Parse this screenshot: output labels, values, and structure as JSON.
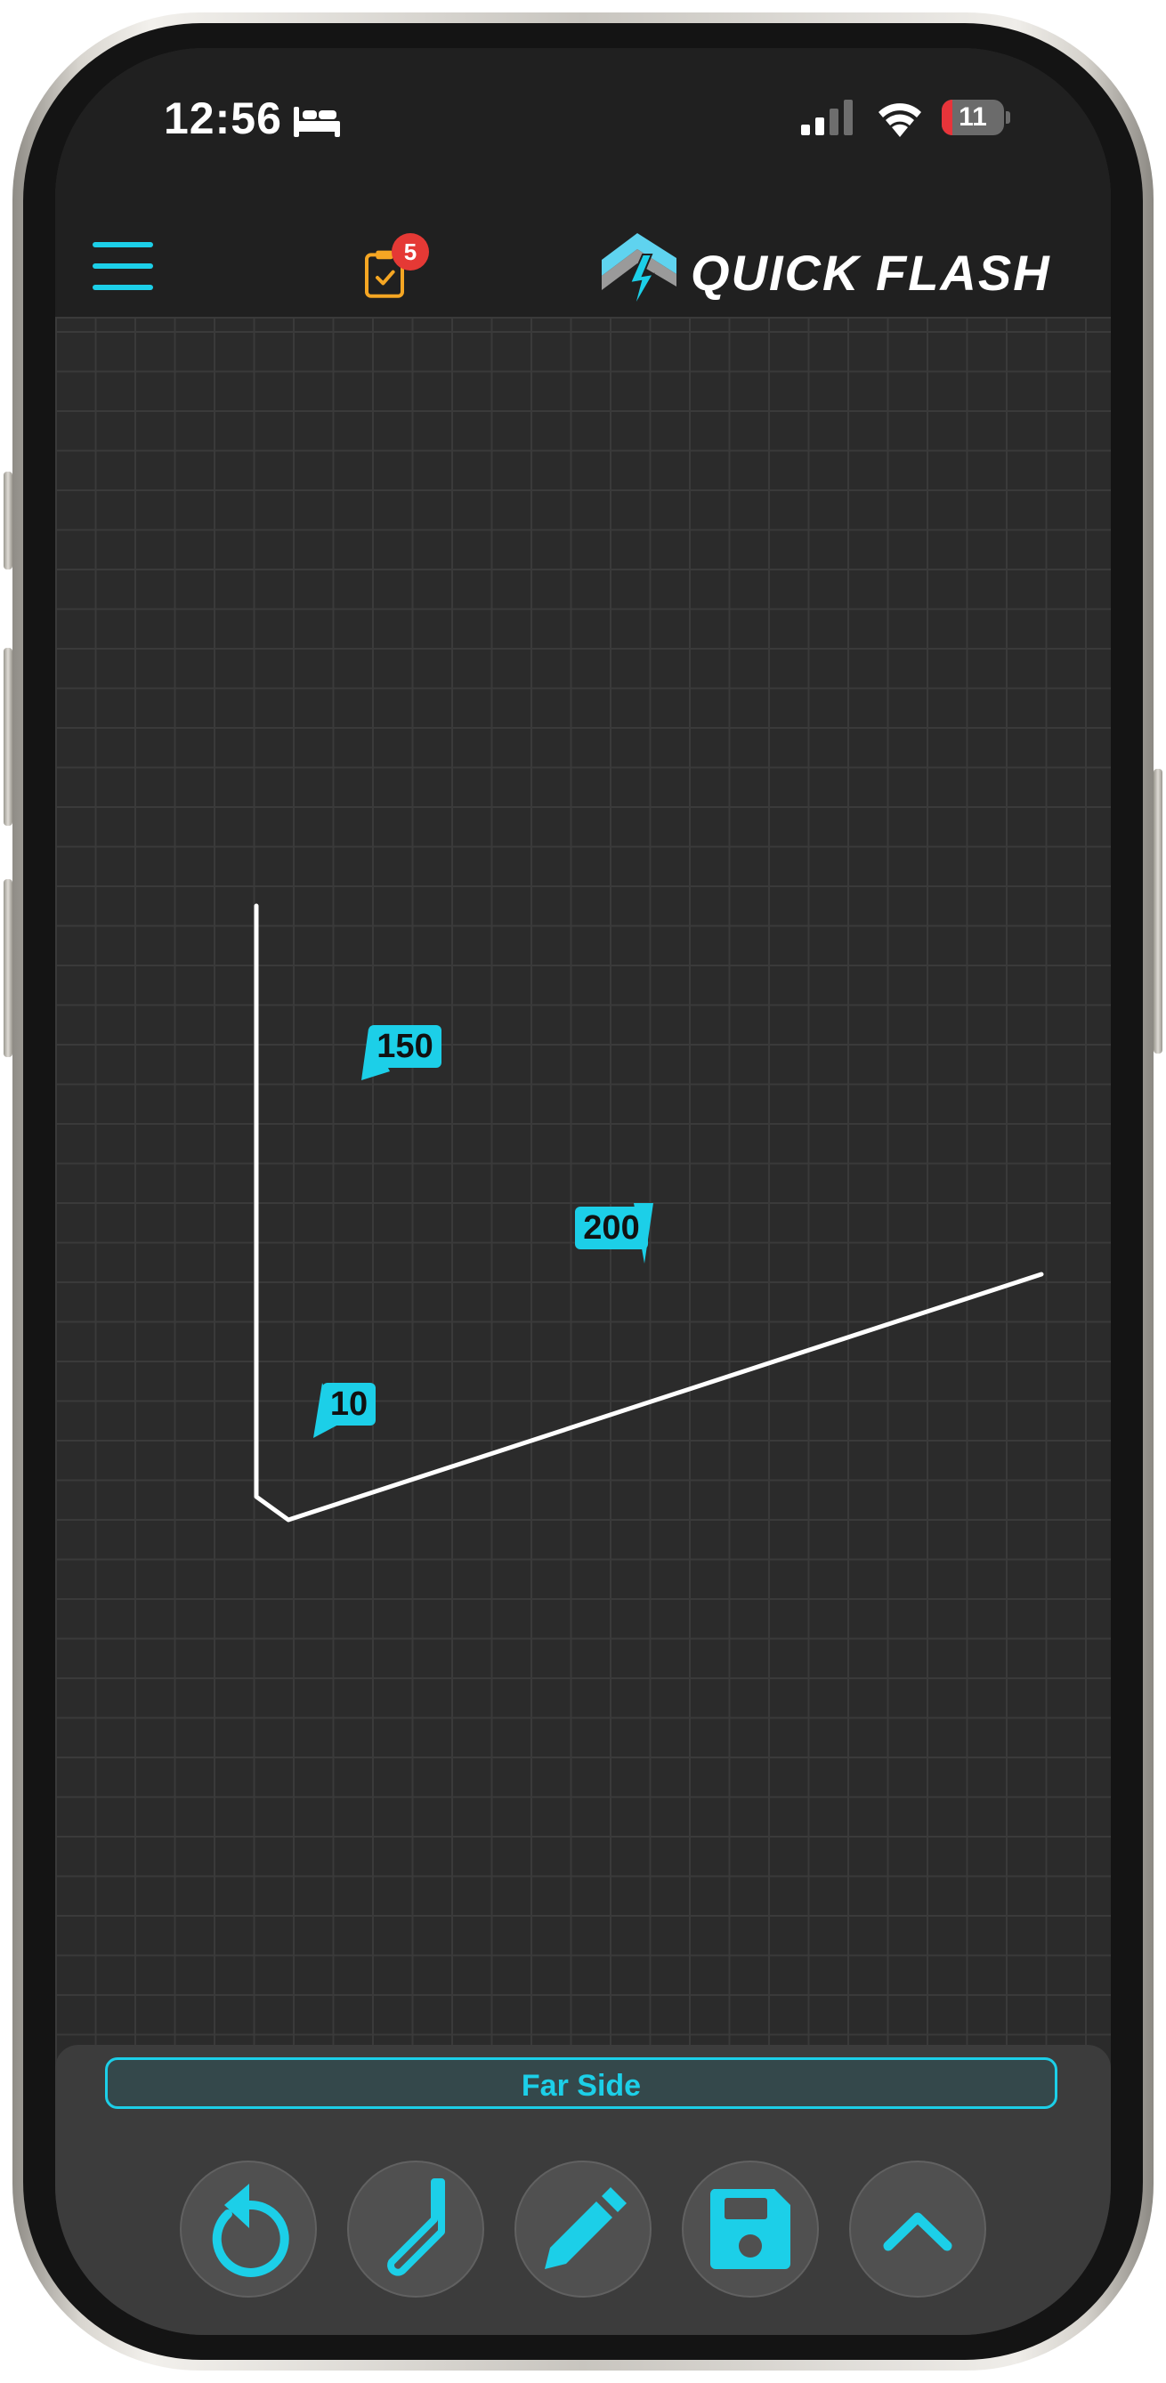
{
  "status_bar": {
    "time": "12:56",
    "battery_level": "11"
  },
  "header": {
    "tasks_badge_count": "5",
    "brand_name": "QUICK FLASH"
  },
  "canvas": {
    "dimensions": {
      "label_150": "150",
      "label_200": "200",
      "label_10": "10"
    }
  },
  "bottom_panel": {
    "side_label": "Far Side",
    "tools": [
      {
        "name": "undo",
        "icon": "undo-icon"
      },
      {
        "name": "bend",
        "icon": "bend-icon"
      },
      {
        "name": "edit",
        "icon": "pencil-icon"
      },
      {
        "name": "save",
        "icon": "save-icon"
      },
      {
        "name": "expand",
        "icon": "chevron-up-icon"
      }
    ]
  },
  "colors": {
    "accent": "#1ccfe8",
    "badge": "#e53935",
    "tasks_icon": "#f5a623",
    "background": "#2b2b2b"
  }
}
